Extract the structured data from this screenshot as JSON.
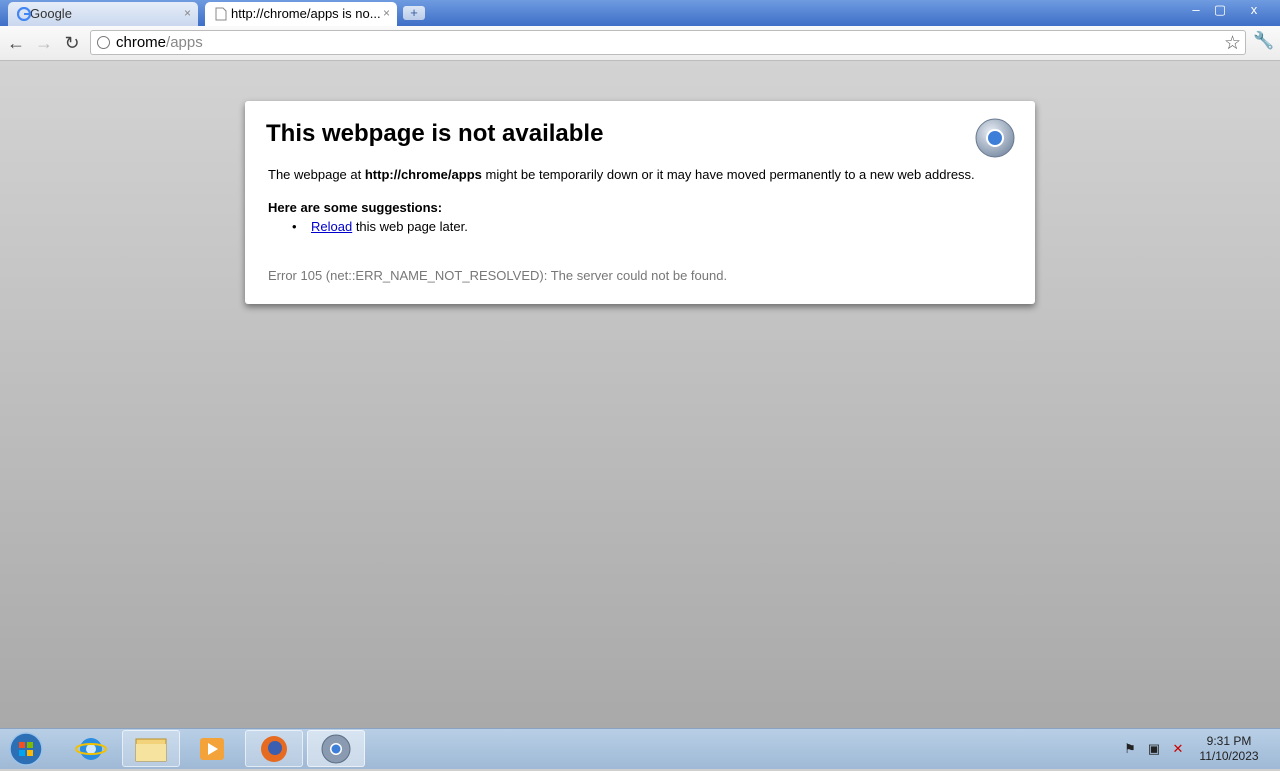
{
  "browser": {
    "tabs": [
      {
        "label": "Google",
        "favicon": "google-icon",
        "active": false
      },
      {
        "label": "http://chrome/apps is no...",
        "favicon": "page-icon",
        "active": true
      }
    ],
    "new_tab_label": "+",
    "window_controls": {
      "minimize": "–",
      "restore": "▢",
      "close": "x"
    },
    "omnibox": {
      "host": "chrome",
      "path": "/apps"
    }
  },
  "error_page": {
    "title": "This webpage is not available",
    "intro_prefix": "The webpage at ",
    "url": "http://chrome/apps",
    "intro_suffix": " might be temporarily down or it may have moved permanently to a new web address.",
    "suggestions_heading": "Here are some suggestions:",
    "reload_link": "Reload",
    "reload_suffix": " this web page later.",
    "error_code": "Error 105 (net::ERR_NAME_NOT_RESOLVED): The server could not be found."
  },
  "taskbar": {
    "apps": [
      "start-orb-icon",
      "internet-explorer-icon",
      "file-explorer-icon",
      "media-player-icon",
      "firefox-icon",
      "chrome-icon"
    ],
    "clock_time": "9:31 PM",
    "clock_date": "11/10/2023"
  },
  "colors": {
    "link": "#0000cc",
    "titlebar": "#3e6fc7",
    "taskbar": "#a9c1dc"
  }
}
